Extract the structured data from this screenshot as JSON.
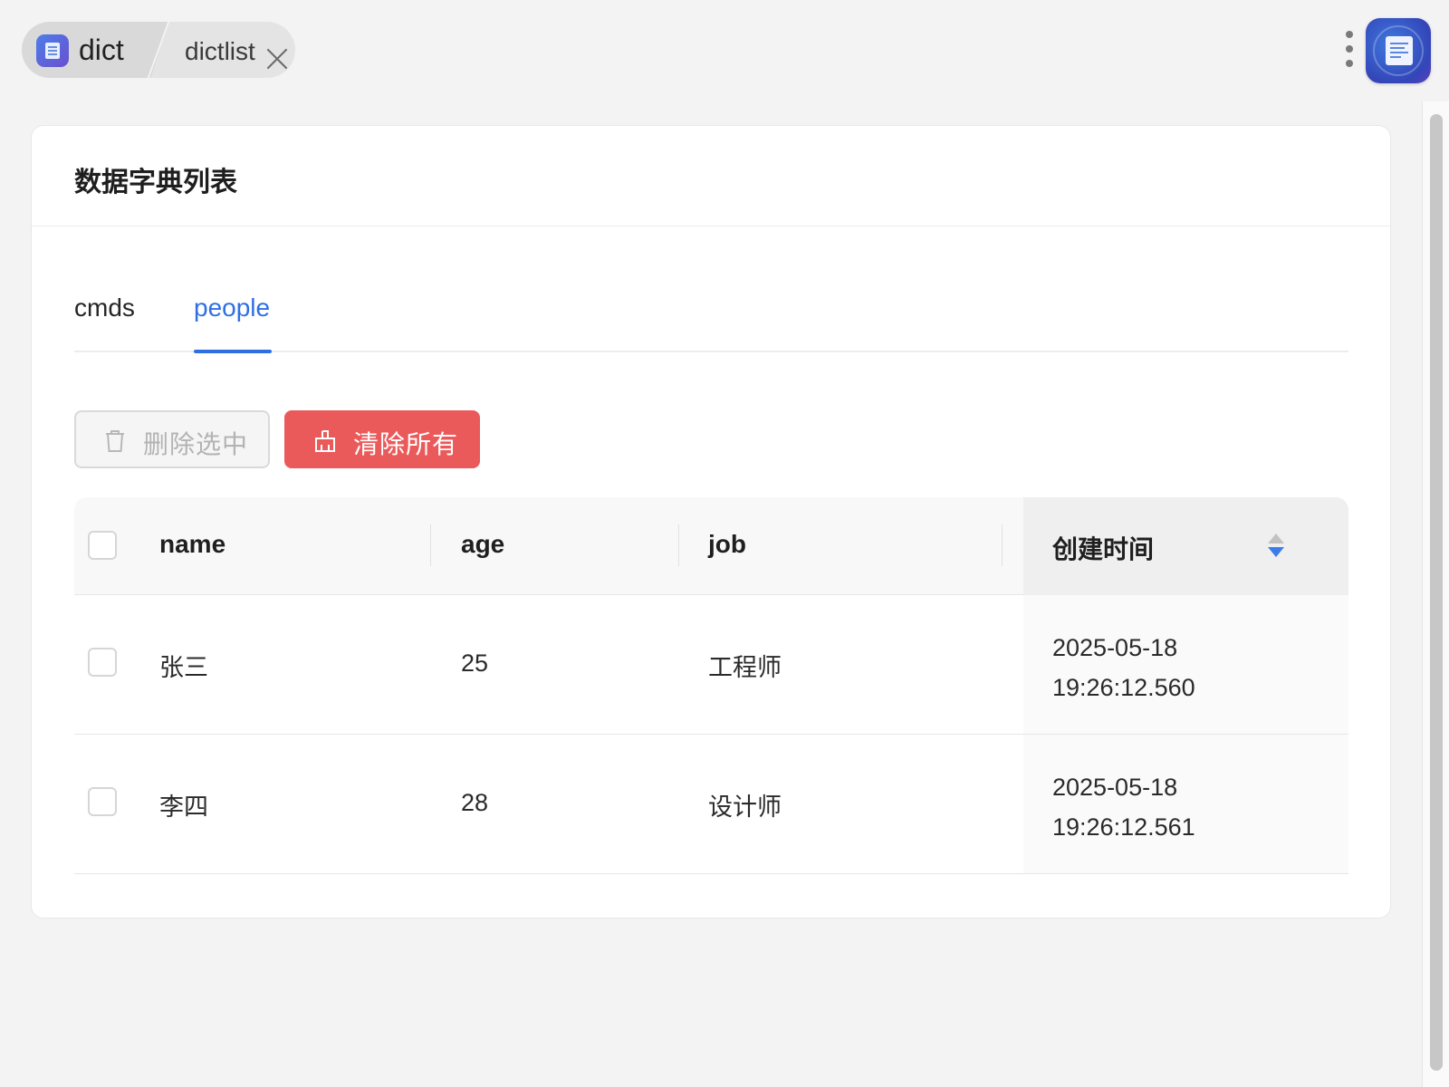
{
  "breadcrumb": {
    "app_label": "dict",
    "page_label": "dictlist"
  },
  "icons": {
    "app": "document-icon",
    "more": "more-vertical-icon",
    "close": "close-icon",
    "delete": "trash-icon",
    "clear": "broom-icon",
    "sort": "sort-icon"
  },
  "card": {
    "title": "数据字典列表"
  },
  "tabs": [
    {
      "label": "cmds",
      "active": false
    },
    {
      "label": "people",
      "active": true
    }
  ],
  "actions": {
    "delete_selected_label": "删除选中",
    "clear_all_label": "清除所有"
  },
  "table": {
    "columns": [
      "name",
      "age",
      "job",
      "创建时间"
    ],
    "sorted_column": "创建时间",
    "sort_direction": "descending",
    "rows": [
      {
        "name": "张三",
        "age": "25",
        "job": "工程师",
        "created_date": "2025-05-18",
        "created_time": "19:26:12.560"
      },
      {
        "name": "李四",
        "age": "28",
        "job": "设计师",
        "created_date": "2025-05-18",
        "created_time": "19:26:12.561"
      }
    ]
  },
  "colors": {
    "accent": "#2f6fe4",
    "danger": "#eb5a5a",
    "background": "#f3f3f3"
  }
}
